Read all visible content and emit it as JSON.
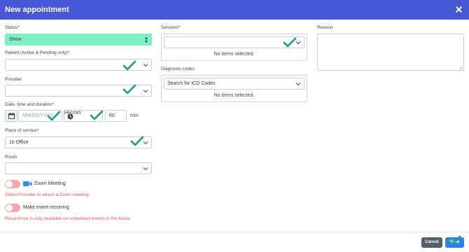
{
  "dialog": {
    "title": "New appointment"
  },
  "status": {
    "label": "Status*",
    "value": "Show"
  },
  "patient": {
    "label": "Patient (Active & Pending only)*",
    "value": ""
  },
  "provider": {
    "label": "Provider",
    "value": ""
  },
  "datetime": {
    "label": "Date, time and duration*",
    "date_placeholder": "MM/DD/YYYY",
    "time_placeholder": "HH:mm",
    "duration": "60",
    "duration_unit": "min"
  },
  "place": {
    "label": "Place of service*",
    "value": "11-Office"
  },
  "room": {
    "label": "Room",
    "value": ""
  },
  "zoom": {
    "label": "Zoom Meeting",
    "warning": "Select Provider to attach a Zoom meeting."
  },
  "recurring": {
    "label": "Make event recurring",
    "warning": "Recurrence is only available on scheduled events in the future."
  },
  "services": {
    "label": "Services*",
    "empty": "No items selected."
  },
  "diagnosis": {
    "label": "Diagnosis codes",
    "placeholder": "Search for ICD Codes",
    "empty": "No items selected."
  },
  "reason": {
    "label": "Reason",
    "value": ""
  },
  "buttons": {
    "cancel": "Cancel",
    "save": "Save"
  },
  "colors": {
    "header": "#4758d6",
    "status_bg": "#7ff0c4",
    "toggle_off": "#f6a7a7",
    "warning": "#e05555",
    "check": "#27a08a",
    "save": "#2f80ed"
  }
}
